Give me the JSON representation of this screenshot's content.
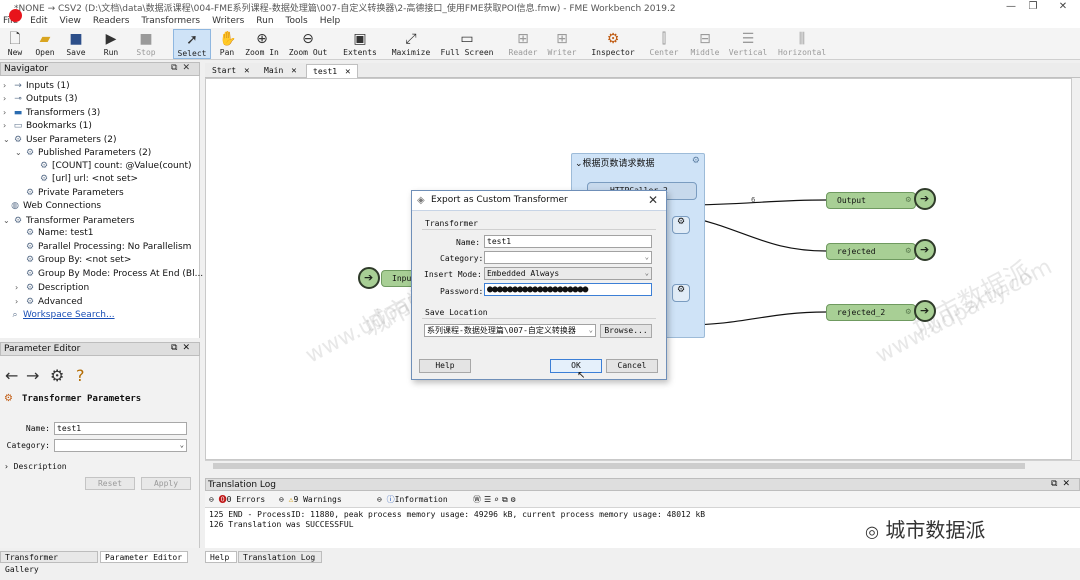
{
  "window": {
    "title": "*NONE → CSV2 (D:\\文档\\data\\数据派课程\\004-FME系列课程-数据处理篇\\007-自定义转换器\\2-高德接口_使用FME获取POI信息.fmw) - FME Workbench 2019.2",
    "controls": [
      "—",
      "❐",
      "✕"
    ]
  },
  "menu": [
    "File",
    "Edit",
    "View",
    "Readers",
    "Transformers",
    "Writers",
    "Run",
    "Tools",
    "Help"
  ],
  "toolbar": {
    "new": "New",
    "open": "Open",
    "save": "Save",
    "run": "Run",
    "stop": "Stop",
    "select": "Select",
    "pan": "Pan",
    "zoom_in": "Zoom In",
    "zoom_out": "Zoom Out",
    "extents": "Extents",
    "maximize": "Maximize",
    "full_screen": "Full Screen",
    "reader": "Reader",
    "writer": "Writer",
    "inspector": "Inspector",
    "center": "Center",
    "middle": "Middle",
    "vertical": "Vertical",
    "horizontal": "Horizontal"
  },
  "navigator": {
    "title": "Navigator",
    "items": [
      {
        "label": "Inputs (1)"
      },
      {
        "label": "Outputs (3)"
      },
      {
        "label": "Transformers (3)"
      },
      {
        "label": "Bookmarks (1)"
      },
      {
        "label": "User Parameters (2)"
      },
      {
        "label": "Published Parameters (2)"
      },
      {
        "label": "[COUNT] count: @Value(count)"
      },
      {
        "label": "[url] url: <not set>"
      },
      {
        "label": "Private Parameters"
      },
      {
        "label": "Web Connections"
      },
      {
        "label": "Transformer Parameters"
      },
      {
        "label": "Name: test1"
      },
      {
        "label": "Parallel Processing: No Parallelism"
      },
      {
        "label": "Group By: <not set>"
      },
      {
        "label": "Group By Mode: Process At End (Bl..."
      },
      {
        "label": "Description"
      },
      {
        "label": "Advanced"
      },
      {
        "label": "Workspace Search..."
      }
    ]
  },
  "param_editor": {
    "title": "Parameter Editor",
    "heading": "Transformer Parameters",
    "name_label": "Name:",
    "name_value": "test1",
    "category_label": "Category:",
    "category_value": "",
    "description": "Description",
    "reset": "Reset",
    "apply": "Apply"
  },
  "bottom_tabs": {
    "transformer_gallery": "Transformer Gallery",
    "parameter_editor": "Parameter Editor",
    "help": "Help",
    "translation_log": "Translation Log"
  },
  "canvas_tabs": [
    "Start",
    "Main",
    "test1"
  ],
  "canvas": {
    "bookmark_title": "根据页数请求数据",
    "caller": "HTTPCaller_2",
    "input_node": "Input",
    "output_node": "Output",
    "rejected_node": "rejected",
    "rejected2_node": "rejected_2",
    "link_count": "6"
  },
  "dialog": {
    "title": "Export as Custom Transformer",
    "transformer_group": "Transformer",
    "name_label": "Name:",
    "name_value": "test1",
    "category_label": "Category:",
    "category_value": "",
    "insert_mode_label": "Insert Mode:",
    "insert_mode_value": "Embedded Always",
    "password_label": "Password:",
    "password_value": "●●●●●●●●●●●●●●●●●●●●",
    "save_group": "Save Location",
    "save_path": "系列课程-数据处理篇\\007-自定义转换器",
    "browse": "Browse...",
    "help": "Help",
    "ok": "OK",
    "cancel": "Cancel"
  },
  "log": {
    "title": "Translation Log",
    "errors": "0 Errors",
    "warnings": "9 Warnings",
    "information": "Information",
    "lines": [
      {
        "num": "125",
        "text": "END - ProcessID: 11880, peak process memory usage: 49296 kB, current process memory usage: 48012 kB"
      },
      {
        "num": "126",
        "text": "Translation was SUCCESSFUL"
      }
    ]
  },
  "watermark": {
    "text": "城市数据派",
    "url": "www.udparty.com",
    "brand": "城市数据派"
  },
  "colors": {
    "node_fill": "#a8cf95",
    "bookmark_fill": "#cfe3f7",
    "accent": "#3c7fd6"
  }
}
